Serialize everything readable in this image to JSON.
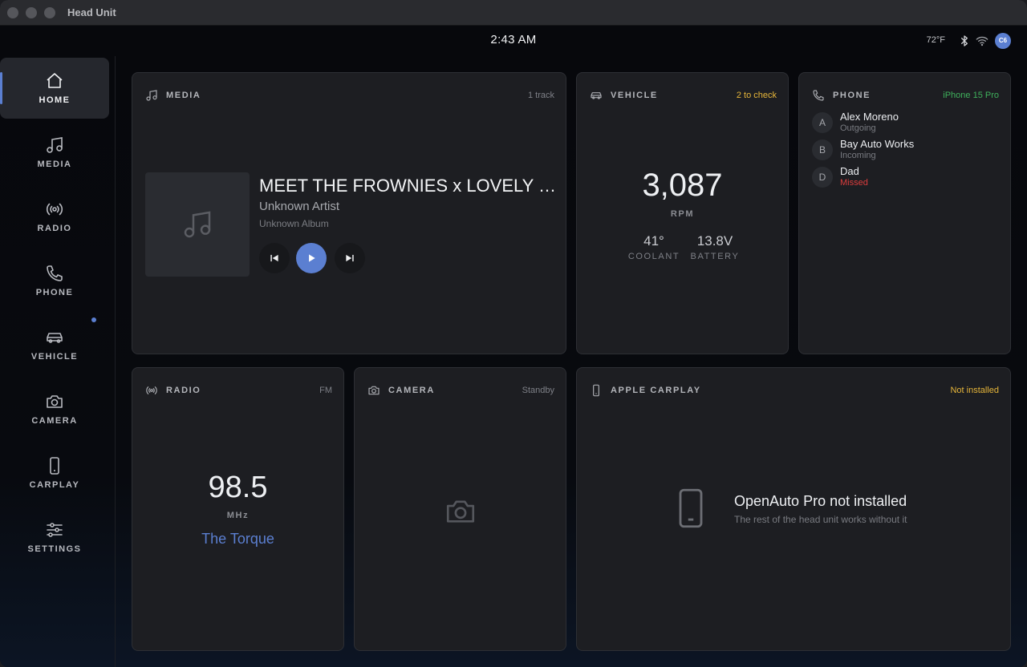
{
  "window": {
    "title": "Head Unit"
  },
  "status": {
    "time": "2:43 AM",
    "temperature": "72°F",
    "avatar_initials": "C6"
  },
  "nav": {
    "items": [
      {
        "label": "HOME",
        "icon": "home-icon",
        "active": true
      },
      {
        "label": "MEDIA",
        "icon": "music-icon"
      },
      {
        "label": "RADIO",
        "icon": "radio-icon"
      },
      {
        "label": "PHONE",
        "icon": "phone-icon"
      },
      {
        "label": "VEHICLE",
        "icon": "car-icon",
        "badge": true
      },
      {
        "label": "CAMERA",
        "icon": "camera-icon"
      },
      {
        "label": "CARPLAY",
        "icon": "smartphone-icon"
      },
      {
        "label": "SETTINGS",
        "icon": "sliders-icon"
      }
    ]
  },
  "media": {
    "title": "MEDIA",
    "meta": "1 track",
    "track_title": "MEET THE FROWNIES x LOVELY DAY",
    "artist": "Unknown Artist",
    "album": "Unknown Album"
  },
  "vehicle": {
    "title": "VEHICLE",
    "meta": "2 to check",
    "rpm_value": "3,087",
    "rpm_label": "RPM",
    "coolant_value": "41°",
    "coolant_label": "COOLANT",
    "battery_value": "13.8V",
    "battery_label": "BATTERY"
  },
  "phone": {
    "title": "PHONE",
    "meta": "iPhone 15 Pro",
    "calls": [
      {
        "initial": "A",
        "name": "Alex Moreno",
        "status": "Outgoing"
      },
      {
        "initial": "B",
        "name": "Bay Auto Works",
        "status": "Incoming"
      },
      {
        "initial": "D",
        "name": "Dad",
        "status": "Missed"
      }
    ]
  },
  "radio": {
    "title": "RADIO",
    "meta": "FM",
    "frequency": "98.5",
    "unit": "MHz",
    "station": "The Torque"
  },
  "camera": {
    "title": "CAMERA",
    "meta": "Standby"
  },
  "carplay": {
    "title": "APPLE CARPLAY",
    "meta": "Not installed",
    "message": "OpenAuto Pro not installed",
    "submessage": "The rest of the head unit works without it"
  },
  "colors": {
    "accent": "#5b7fd1",
    "warning": "#e7b63a",
    "success": "#3fb15c",
    "danger": "#dc3d3d"
  }
}
